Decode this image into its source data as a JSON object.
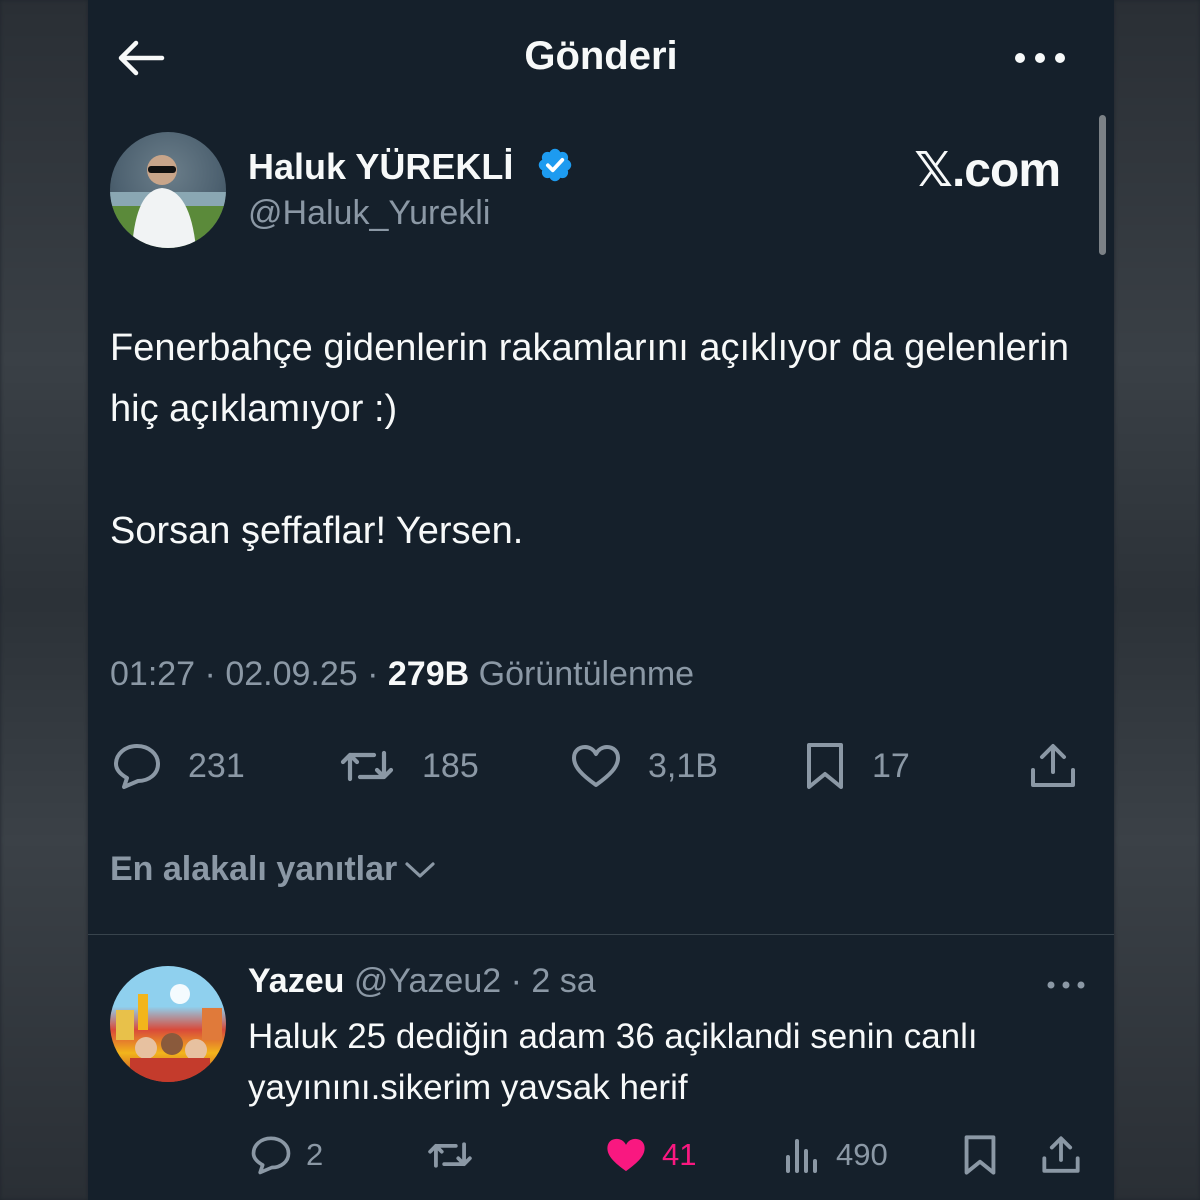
{
  "header": {
    "title": "Gönderi"
  },
  "brand": {
    "watermark": "𝕏.com"
  },
  "author": {
    "name": "Haluk YÜREKLİ",
    "handle": "@Haluk_Yurekli"
  },
  "tweet": {
    "paragraphs": [
      "Fenerbahçe gidenlerin rakamlarını açıklıyor da gelenlerin hiç açıklamıyor :)",
      "Sorsan şeffaflar! Yersen."
    ],
    "time": "01:27",
    "date": "02.09.25",
    "views_count": "279B",
    "views_label": "Görüntülenme",
    "stats": {
      "replies": "231",
      "reposts": "185",
      "likes": "3,1B",
      "bookmarks": "17"
    }
  },
  "replies_filter": {
    "label": "En alakalı yanıtlar"
  },
  "reply": {
    "name": "Yazeu",
    "handle": "@Yazeu2",
    "age": "2 sa",
    "text": "Haluk 25 dediğin adam 36 açiklandi senin canlı yayınını.sikerim yavsak herif",
    "stats": {
      "replies": "2",
      "likes": "41",
      "views": "490"
    },
    "liked": true
  },
  "colors": {
    "background": "#15202b",
    "accent": "#1d9bf0",
    "like": "#f91880",
    "muted": "#8b98a5",
    "text": "#f7f9f9"
  }
}
